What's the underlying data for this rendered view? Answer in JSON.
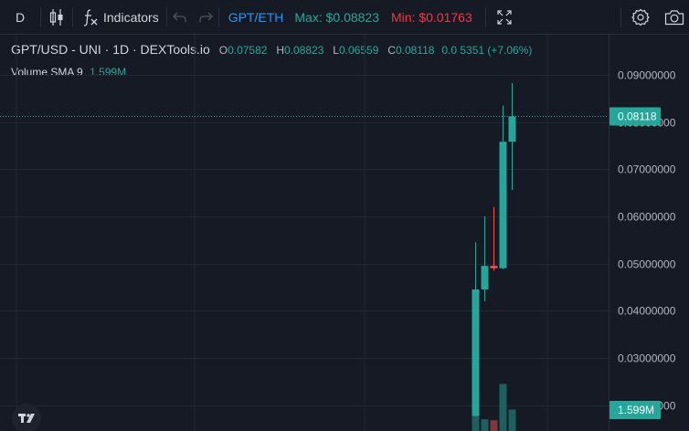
{
  "toolbar": {
    "interval": "D",
    "indicators_label": "Indicators",
    "pair": "GPT/ETH",
    "max_label": "Max: $0.08823",
    "min_label": "Min: $0.01763"
  },
  "legend": {
    "title": "GPT/USD - UNI · 1D · DEXTools.io",
    "open_key": "O",
    "open": "0.07582",
    "high_key": "H",
    "high": "0.08823",
    "low_key": "L",
    "low": "0.06559",
    "close_key": "C",
    "close": "0.08118",
    "change": "0.0 5351 (+7.06%)",
    "volume_label": "Volume SMA 9",
    "volume_value": "1.599M"
  },
  "price_tag": "0.08118",
  "volume_tag": "1.599M",
  "colors": {
    "up": "#26a69a",
    "down": "#ef5350",
    "accent": "#2196f3",
    "max": "#26a69a",
    "min": "#f23645",
    "background": "#161a25"
  },
  "icons": [
    "candles-icon",
    "fx-icon",
    "undo-icon",
    "redo-icon",
    "fullscreen-icon",
    "settings-icon",
    "camera-icon",
    "tradingview-logo"
  ],
  "chart_data": {
    "type": "candlestick",
    "y_ticks": [
      "0.09000000",
      "0.08000000",
      "0.07000000",
      "0.06000000",
      "0.05000000",
      "0.04000000",
      "0.03000000",
      "0.02000000"
    ],
    "ylim": [
      0.0145,
      0.0985
    ],
    "last_price": 0.08118,
    "grid": true,
    "candles": [
      {
        "open": 0.0177,
        "high": 0.0545,
        "low": 0.0176,
        "close": 0.0445
      },
      {
        "open": 0.0445,
        "high": 0.06,
        "low": 0.042,
        "close": 0.0495
      },
      {
        "open": 0.0495,
        "high": 0.062,
        "low": 0.0485,
        "close": 0.049
      },
      {
        "open": 0.049,
        "high": 0.0835,
        "low": 0.0488,
        "close": 0.0758
      },
      {
        "open": 0.07582,
        "high": 0.08823,
        "low": 0.06559,
        "close": 0.08118
      }
    ],
    "volume": [
      0.64,
      0.26,
      0.24,
      1.05,
      0.48
    ]
  }
}
